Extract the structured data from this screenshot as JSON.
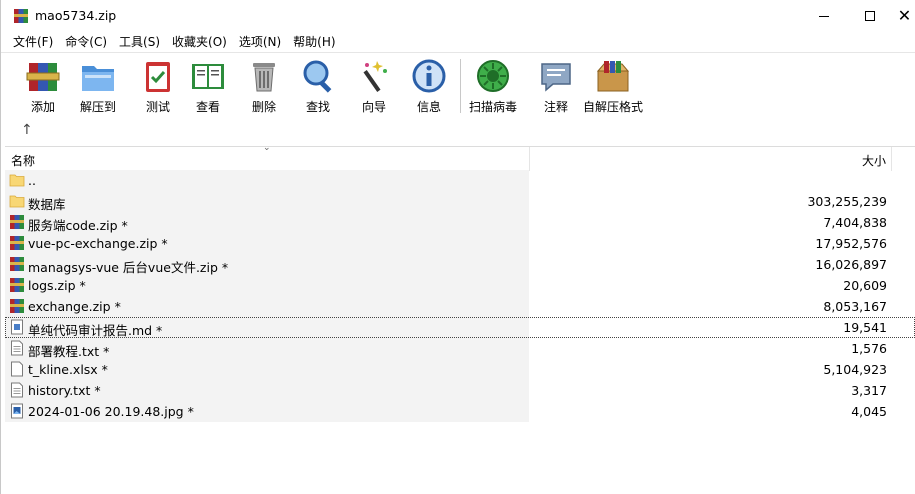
{
  "window": {
    "title": "mao5734.zip",
    "close_glyph": "✕"
  },
  "menu": [
    {
      "label": "文件(F)"
    },
    {
      "label": "命令(C)"
    },
    {
      "label": "工具(S)"
    },
    {
      "label": "收藏夹(O)"
    },
    {
      "label": "选项(N)"
    },
    {
      "label": "帮助(H)"
    }
  ],
  "toolbar": [
    {
      "label": "添加",
      "icon": "add-archive-icon"
    },
    {
      "label": "解压到",
      "icon": "extract-folder-icon"
    },
    {
      "label": "测试",
      "icon": "test-clipboard-icon"
    },
    {
      "label": "查看",
      "icon": "view-book-icon"
    },
    {
      "label": "删除",
      "icon": "trash-icon"
    },
    {
      "label": "查找",
      "icon": "magnifier-icon"
    },
    {
      "label": "向导",
      "icon": "wizard-wand-icon"
    },
    {
      "label": "信息",
      "icon": "info-icon"
    },
    {
      "label": "扫描病毒",
      "icon": "virus-scan-icon"
    },
    {
      "label": "注释",
      "icon": "comment-icon"
    },
    {
      "label": "自解压格式",
      "icon": "sfx-box-icon"
    }
  ],
  "path": {
    "up_glyph": "↑"
  },
  "columns": {
    "name": "名称",
    "size": "大小",
    "sort_glyph": "⌄"
  },
  "files": [
    {
      "name": "..",
      "size": "",
      "type": "folder"
    },
    {
      "name": "数据库",
      "size": "303,255,239",
      "type": "folder"
    },
    {
      "name": "服务端code.zip *",
      "size": "7,404,838",
      "type": "archive"
    },
    {
      "name": "vue-pc-exchange.zip *",
      "size": "17,952,576",
      "type": "archive"
    },
    {
      "name": "managsys-vue  后台vue文件.zip *",
      "size": "16,026,897",
      "type": "archive"
    },
    {
      "name": "logs.zip *",
      "size": "20,609",
      "type": "archive"
    },
    {
      "name": "exchange.zip *",
      "size": "8,053,167",
      "type": "archive"
    },
    {
      "name": "单纯代码审计报告.md *",
      "size": "19,541",
      "type": "md"
    },
    {
      "name": "部署教程.txt *",
      "size": "1,576",
      "type": "text"
    },
    {
      "name": "t_kline.xlsx *",
      "size": "5,104,923",
      "type": "doc"
    },
    {
      "name": "history.txt *",
      "size": "3,317",
      "type": "text"
    },
    {
      "name": "2024-01-06 20.19.48.jpg *",
      "size": "4,045",
      "type": "image"
    }
  ],
  "colors": {
    "folder": "#f8d775",
    "archive_red": "#b0252a",
    "archive_blue": "#3457b2"
  }
}
